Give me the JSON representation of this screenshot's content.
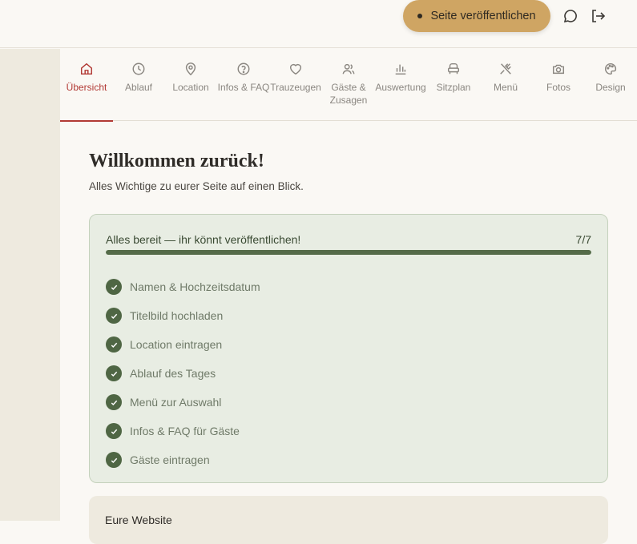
{
  "header": {
    "publish_label": "Seite veröffentlichen",
    "icons": [
      "chat-bubble-icon",
      "logout-icon"
    ]
  },
  "tabs": [
    {
      "label": "Übersicht",
      "icon": "home-icon",
      "active": true
    },
    {
      "label": "Ablauf",
      "icon": "clock-icon"
    },
    {
      "label": "Location",
      "icon": "map-pin-icon"
    },
    {
      "label": "Infos & FAQ",
      "icon": "help-circle-icon"
    },
    {
      "label": "Trauzeugen",
      "icon": "heart-icon"
    },
    {
      "label": "Gäste & Zusagen",
      "icon": "users-icon"
    },
    {
      "label": "Auswertung",
      "icon": "bar-chart-icon"
    },
    {
      "label": "Sitzplan",
      "icon": "chair-icon"
    },
    {
      "label": "Menü",
      "icon": "utensils-icon"
    },
    {
      "label": "Fotos",
      "icon": "camera-icon"
    },
    {
      "label": "Design",
      "icon": "palette-icon"
    }
  ],
  "main": {
    "title": "Willkommen zurück!",
    "subtitle": "Alles Wichtige zu eurer Seite auf einen Blick."
  },
  "progress_card": {
    "heading": "Alles bereit — ihr könnt veröffentlichen!",
    "count": "7/7",
    "progress_fraction": 1.0,
    "items": [
      "Namen & Hochzeitsdatum",
      "Titelbild hochladen",
      "Location eintragen",
      "Ablauf des Tages",
      "Menü zur Auswahl",
      "Infos & FAQ für Gäste",
      "Gäste eintragen"
    ]
  },
  "website_card": {
    "title": "Eure Website"
  },
  "colors": {
    "accent": "#b23a35",
    "publish": "#cfa563",
    "success": "#4f6644"
  }
}
